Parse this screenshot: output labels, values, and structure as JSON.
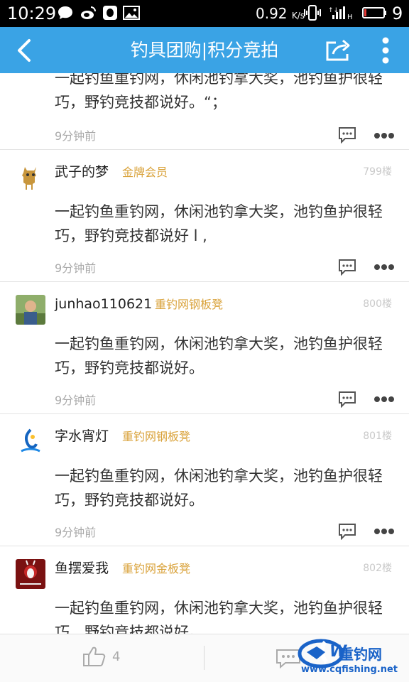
{
  "status_bar": {
    "time": "10:29",
    "network_speed": "0.92",
    "network_unit": "K/s",
    "battery_level": "9",
    "icons": [
      "message-icon",
      "weibo-icon",
      "qq-icon",
      "gallery-icon",
      "vibrate-icon",
      "signal-icon",
      "battery-icon"
    ]
  },
  "header": {
    "title": "钓具团购|积分竞拍",
    "back_icon": "back-icon",
    "share_icon": "share-icon",
    "menu_icon": "more-vertical-icon",
    "color": "#3aa3e5"
  },
  "first_post_partial": {
    "content": "一起钓鱼重钓网，休闲池钓拿大奖，池钓鱼护很轻巧，野钓竞技都说好。“；",
    "time": "9分钟前"
  },
  "posts": [
    {
      "username": "武子的梦",
      "badge": "金牌会员",
      "floor": "799楼",
      "content": "一起钓鱼重钓网，休闲池钓拿大奖，池钓鱼护很轻巧，野钓竞技都说好 l ,",
      "time": "9分钟前"
    },
    {
      "username": "junhao110621",
      "badge": "重钓网钢板凳",
      "floor": "800楼",
      "content": "一起钓鱼重钓网，休闲池钓拿大奖，池钓鱼护很轻巧，野钓竞技都说好。",
      "time": "9分钟前"
    },
    {
      "username": "字水宵灯",
      "badge": "重钓网钢板凳",
      "floor": "801楼",
      "content": "一起钓鱼重钓网，休闲池钓拿大奖，池钓鱼护很轻巧，野钓竞技都说好。",
      "time": "9分钟前"
    },
    {
      "username": "鱼摆爱我",
      "badge": "重钓网金板凳",
      "floor": "802楼",
      "content": "一起钓鱼重钓网，休闲池钓拿大奖，池钓鱼护很轻巧，野钓竞技都说好。",
      "time": ""
    }
  ],
  "bottom_bar": {
    "like_count": "4",
    "like_icon": "thumbs-up-icon",
    "comment_icon": "comment-icon"
  },
  "watermark": {
    "brand": "重钓网",
    "url": "www.cqfishing.net"
  },
  "colors": {
    "badge": "#d9a23a",
    "floor": "#c9c9c9",
    "time": "#aaaaaa"
  }
}
